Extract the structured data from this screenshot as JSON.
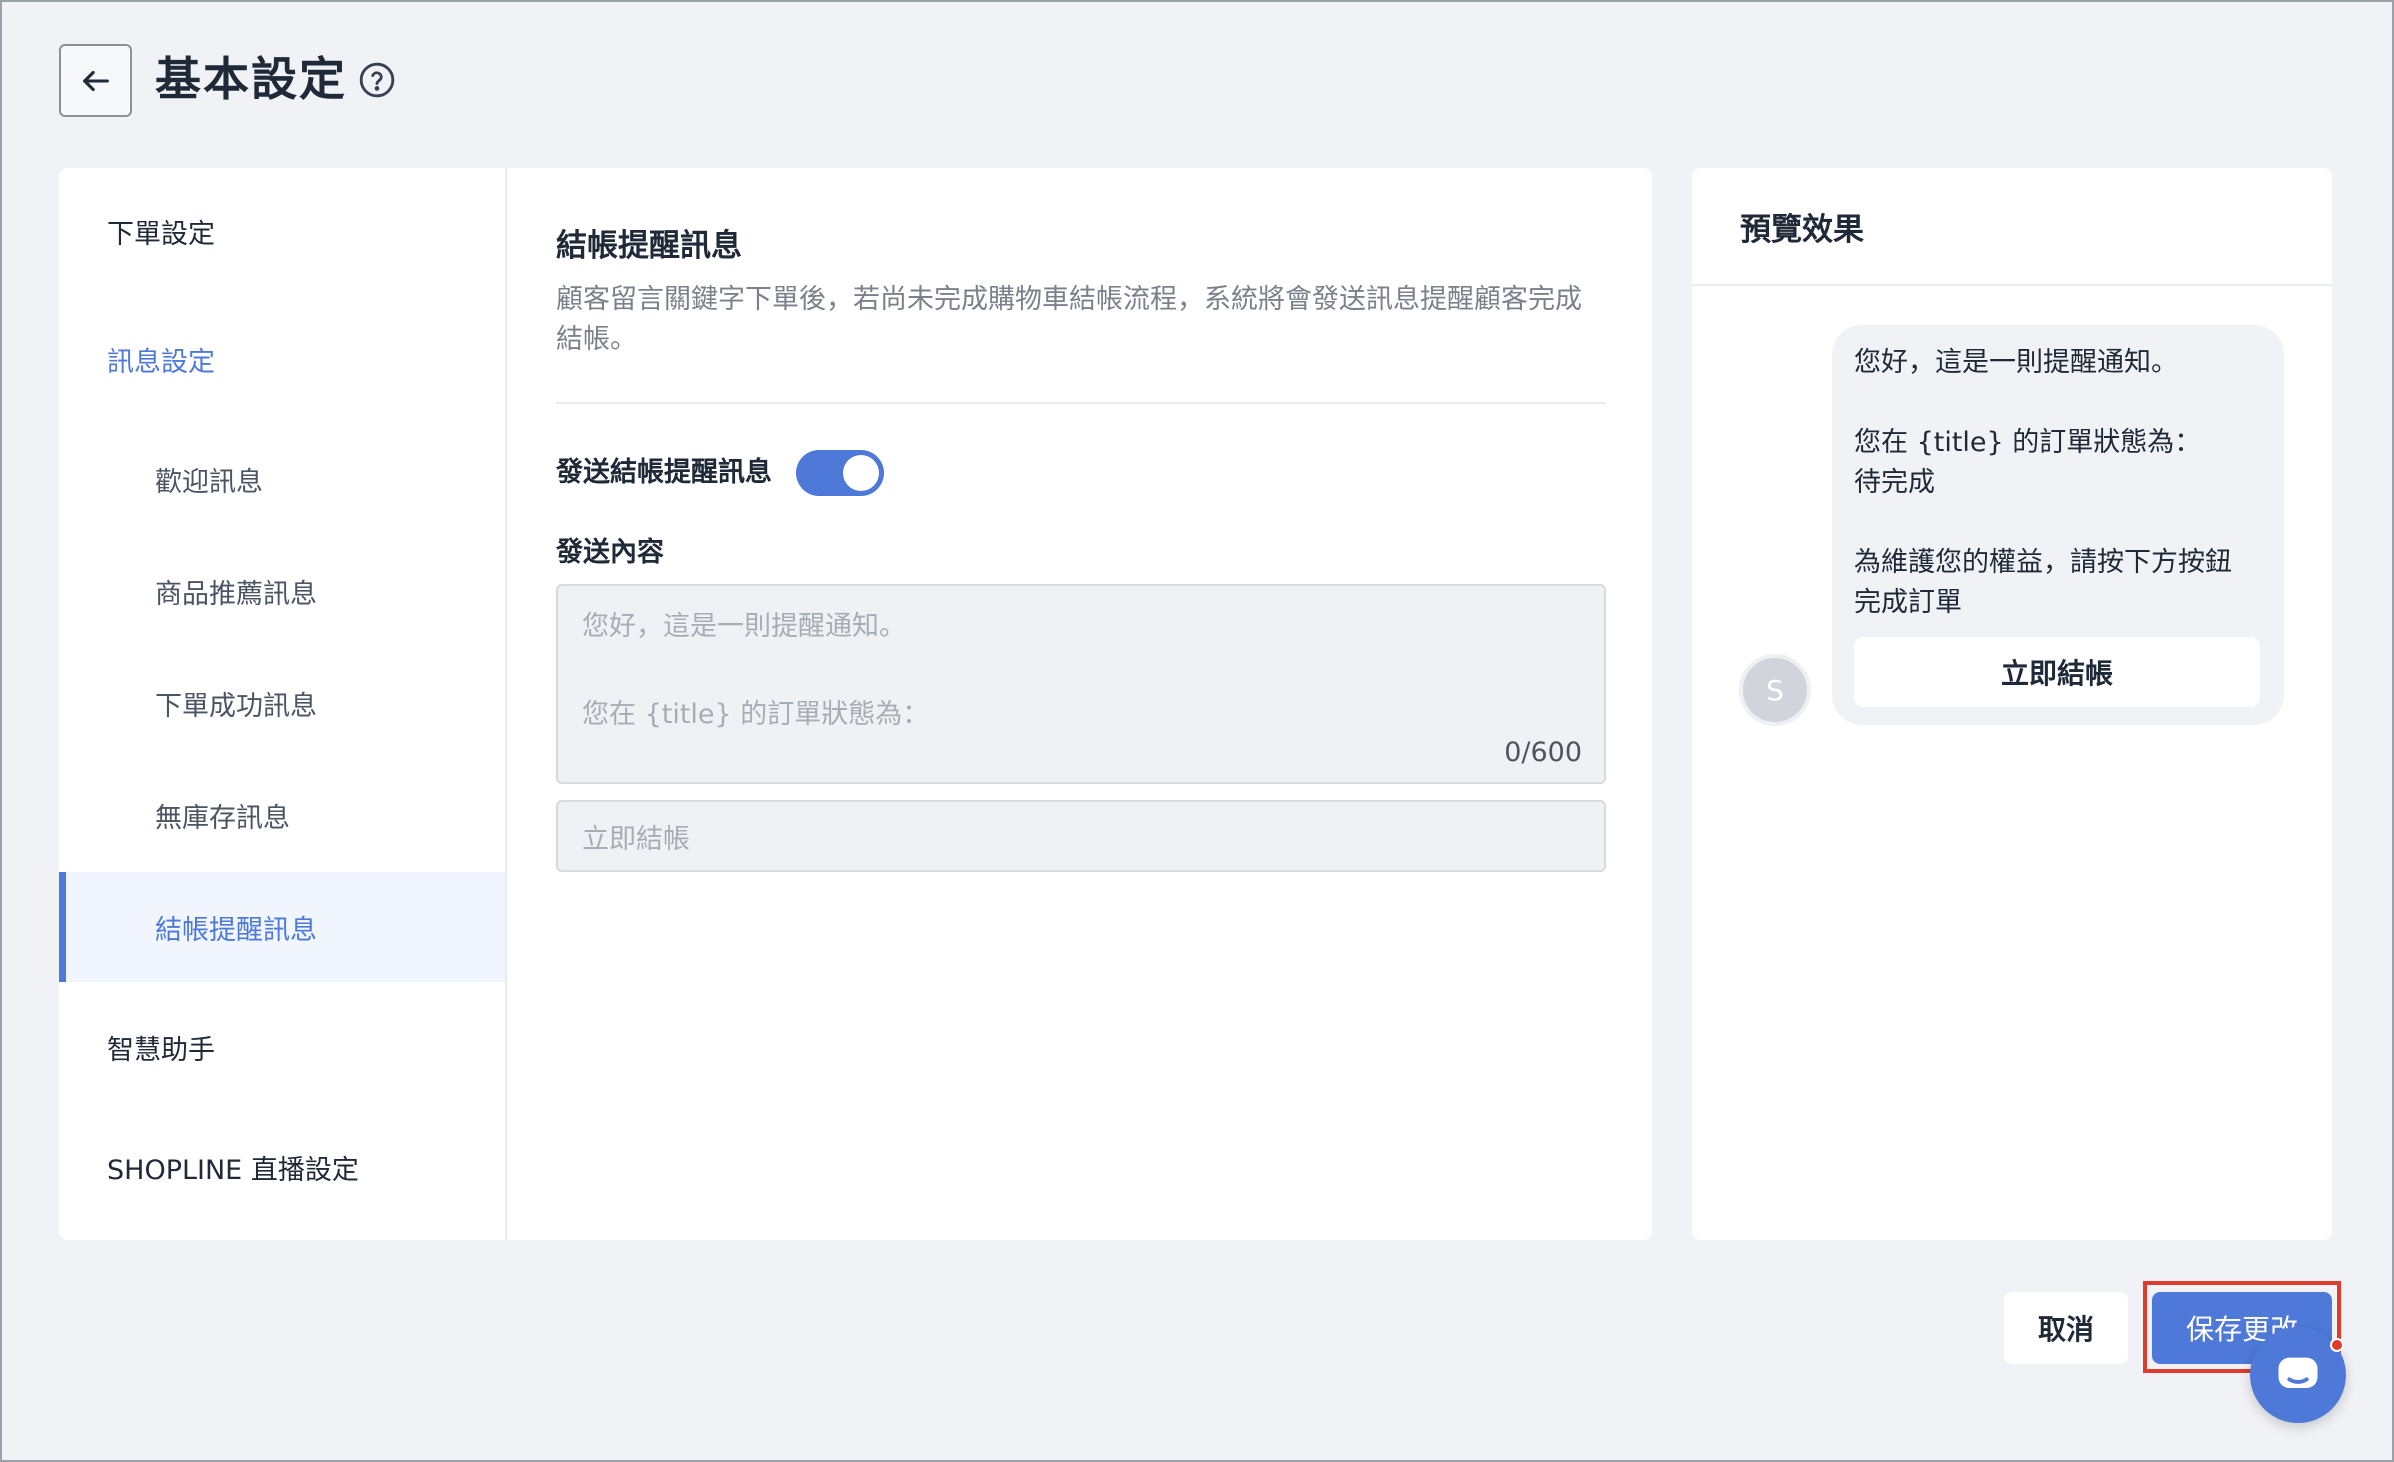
{
  "header": {
    "title": "基本設定"
  },
  "sidebar": {
    "items": [
      {
        "label": "下單設定"
      },
      {
        "label": "訊息設定"
      },
      {
        "label": "歡迎訊息"
      },
      {
        "label": "商品推薦訊息"
      },
      {
        "label": "下單成功訊息"
      },
      {
        "label": "無庫存訊息"
      },
      {
        "label": "結帳提醒訊息"
      },
      {
        "label": "智慧助手"
      },
      {
        "label": "SHOPLINE 直播設定"
      }
    ]
  },
  "form": {
    "section_title": "結帳提醒訊息",
    "section_desc": "顧客留言關鍵字下單後，若尚未完成購物車結帳流程，系統將會發送訊息提醒顧客完成結帳。",
    "toggle_label": "發送結帳提醒訊息",
    "toggle_on": true,
    "content_label": "發送內容",
    "textarea_line1": "您好，這是一則提醒通知。",
    "textarea_line2": "您在 {title} 的訂單狀態為：",
    "counter": "0/600",
    "button_placeholder": "立即結帳"
  },
  "preview": {
    "title": "預覽效果",
    "avatar_initial": "S",
    "message": {
      "line1": "您好，這是一則提醒通知。",
      "line2": "您在 {title} 的訂單狀態為：",
      "line3": "待完成",
      "line4": "為維護您的權益，請按下方按鈕",
      "line5": "完成訂單"
    },
    "button": "立即結帳"
  },
  "footer": {
    "cancel": "取消",
    "save": "保存更改"
  },
  "colors": {
    "accent": "#4f79d9",
    "highlight": "#e03c2d",
    "background": "#f1f2f6"
  },
  "icons": [
    "back-arrow-icon",
    "help-circle-icon",
    "chat-bubble-icon"
  ]
}
